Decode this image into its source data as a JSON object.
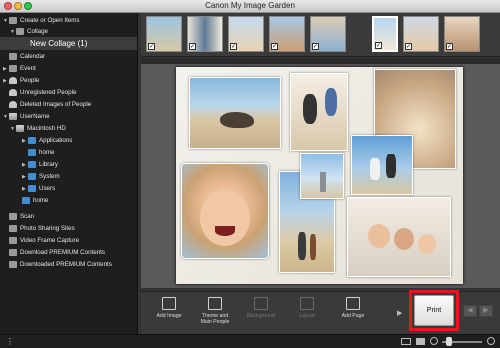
{
  "window": {
    "title": "Canon My Image Garden"
  },
  "sidebar": {
    "items": [
      {
        "label": "Create or Open Items",
        "icon": "create-icon"
      },
      {
        "label": "Collage",
        "icon": "collage-icon"
      },
      {
        "label": "New Collage (1)",
        "icon": ""
      },
      {
        "label": "Calendar",
        "icon": "calendar-icon"
      },
      {
        "label": "Event",
        "icon": "event-icon"
      },
      {
        "label": "People",
        "icon": "people-icon"
      },
      {
        "label": "Unregistered People",
        "icon": "person-icon"
      },
      {
        "label": "Deleted Images of People",
        "icon": "person-icon"
      },
      {
        "label": "UserName",
        "icon": "user-icon"
      },
      {
        "label": "Macintosh HD",
        "icon": "disk-icon"
      },
      {
        "label": "Applications",
        "icon": "folder-icon"
      },
      {
        "label": "home",
        "icon": "folder-icon"
      },
      {
        "label": "Library",
        "icon": "folder-icon"
      },
      {
        "label": "System",
        "icon": "folder-icon"
      },
      {
        "label": "Users",
        "icon": "folder-icon"
      },
      {
        "label": "home",
        "icon": "folder-icon"
      },
      {
        "label": "Scan",
        "icon": "scan-icon"
      },
      {
        "label": "Photo Sharing Sites",
        "icon": "globe-icon"
      },
      {
        "label": "Video Frame Capture",
        "icon": "film-icon"
      },
      {
        "label": "Download PREMIUM Contents",
        "icon": "download-icon"
      },
      {
        "label": "Downloaded PREMIUM Contents",
        "icon": "download-icon"
      }
    ]
  },
  "toolbar": {
    "add_image": "Add Image",
    "theme_line1": "Theme and",
    "theme_line2": "Main People",
    "background": "Background",
    "layout": "Layout",
    "add_page": "Add Page",
    "print": "Print"
  },
  "colors": {
    "highlight": "#e6161c",
    "selection": "#3c3c3c"
  }
}
